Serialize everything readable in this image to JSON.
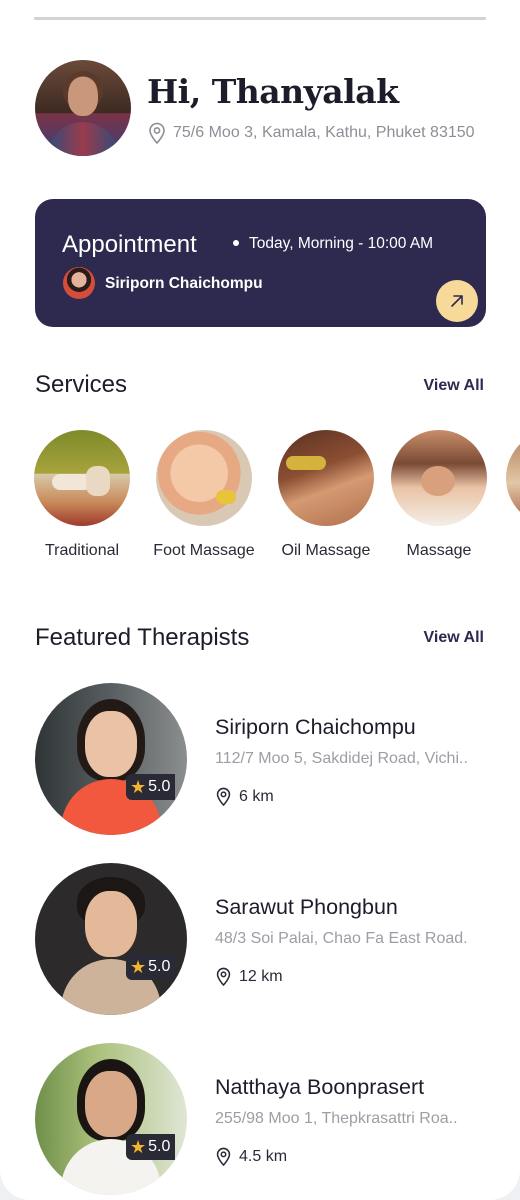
{
  "header": {
    "greeting": "Hi, Thanyalak",
    "address": "75/6 Moo 3, Kamala, Kathu, Phuket 83150",
    "icons": {
      "avatar": "user-avatar",
      "location": "location-pin-icon"
    }
  },
  "appointment": {
    "title": "Appointment",
    "time": "Today, Morning - 10:00 AM",
    "therapist_name": "Siriporn Chaichompu",
    "action_icon": "arrow-up-right-icon"
  },
  "services": {
    "title": "Services",
    "view_all": "View All",
    "items": [
      {
        "label": "Traditional"
      },
      {
        "label": "Foot Massage"
      },
      {
        "label": "Oil Massage"
      },
      {
        "label": "Massage"
      },
      {
        "label": ""
      }
    ]
  },
  "therapists": {
    "title": "Featured Therapists",
    "view_all": "View All",
    "items": [
      {
        "name": "Siriporn Chaichompu",
        "address": "112/7 Moo 5, Sakdidej Road, Vichi..",
        "distance": "6 km",
        "rating": "5.0"
      },
      {
        "name": "Sarawut Phongbun",
        "address": "48/3 Soi Palai, Chao Fa East Road.",
        "distance": "12 km",
        "rating": "5.0"
      },
      {
        "name": "Natthaya Boonprasert",
        "address": "255/98 Moo 1, Thepkrasattri Roa..",
        "distance": "4.5 km",
        "rating": "5.0"
      }
    ]
  },
  "colors": {
    "card": "#2e2a4f",
    "accent": "#f7d99a",
    "star": "#f4b52e",
    "muted": "#9d9da5"
  }
}
